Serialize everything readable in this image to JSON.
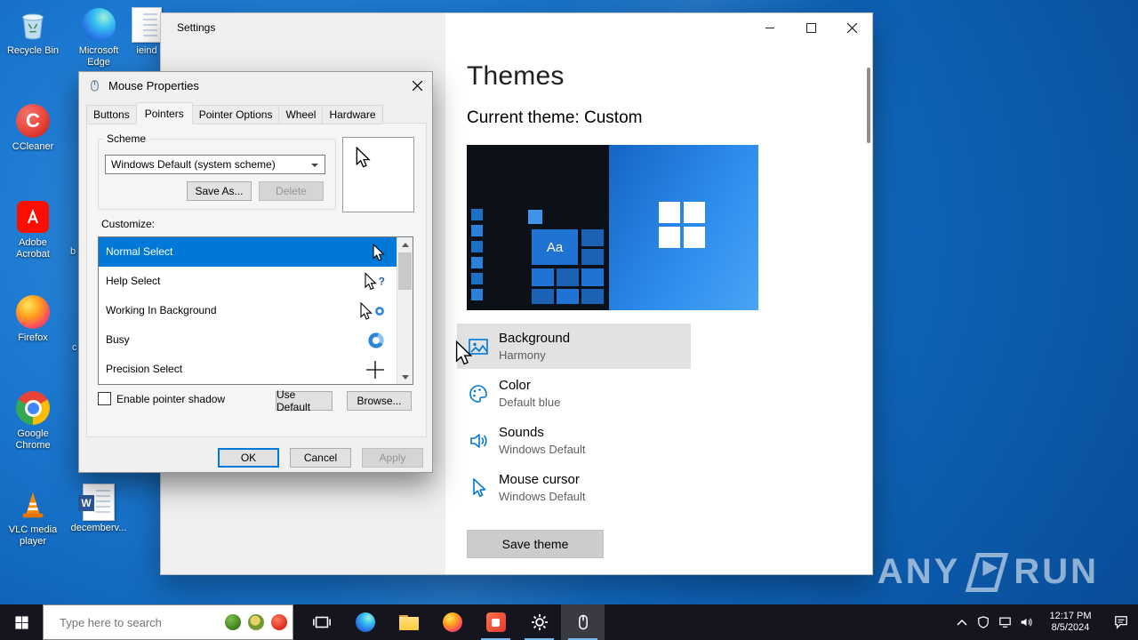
{
  "desktop": {
    "icons": [
      {
        "label": "Recycle Bin"
      },
      {
        "label": "Microsoft Edge"
      },
      {
        "label": "CCleaner"
      },
      {
        "label": "Adobe Acrobat"
      },
      {
        "label": "Firefox"
      },
      {
        "label": "Google Chrome"
      },
      {
        "label": "VLC media player"
      },
      {
        "label": "decemberv..."
      },
      {
        "label": "ieind"
      },
      {
        "label": "b"
      },
      {
        "label": "c"
      }
    ]
  },
  "settings": {
    "window_title": "Settings",
    "page_title": "Themes",
    "current_theme_label": "Current theme: Custom",
    "rows": [
      {
        "title": "Background",
        "value": "Harmony"
      },
      {
        "title": "Color",
        "value": "Default blue"
      },
      {
        "title": "Sounds",
        "value": "Windows Default"
      },
      {
        "title": "Mouse cursor",
        "value": "Windows Default"
      }
    ],
    "save_button": "Save theme"
  },
  "dialog": {
    "title": "Mouse Properties",
    "tabs": [
      "Buttons",
      "Pointers",
      "Pointer Options",
      "Wheel",
      "Hardware"
    ],
    "active_tab": "Pointers",
    "scheme_label": "Scheme",
    "scheme_value": "Windows Default (system scheme)",
    "save_as": "Save As...",
    "delete": "Delete",
    "customize_label": "Customize:",
    "pointers": [
      {
        "name": "Normal Select",
        "selected": true
      },
      {
        "name": "Help Select",
        "selected": false
      },
      {
        "name": "Working In Background",
        "selected": false
      },
      {
        "name": "Busy",
        "selected": false
      },
      {
        "name": "Precision Select",
        "selected": false
      }
    ],
    "shadow_checkbox": "Enable pointer shadow",
    "use_default": "Use Default",
    "browse": "Browse...",
    "ok": "OK",
    "cancel": "Cancel",
    "apply": "Apply"
  },
  "taskbar": {
    "search_placeholder": "Type here to search",
    "clock_time": "12:17 PM",
    "clock_date": "8/5/2024"
  },
  "watermark": {
    "left": "ANY",
    "right": "RUN"
  },
  "glyphs": {
    "aa": "Aa",
    "help_mark": "?",
    "ccleaner": "C",
    "word": "W"
  },
  "colors": {
    "accent": "#0078d7",
    "selection": "#0078d7",
    "taskbar": "#15151f",
    "desktop": "#1c79d1"
  }
}
